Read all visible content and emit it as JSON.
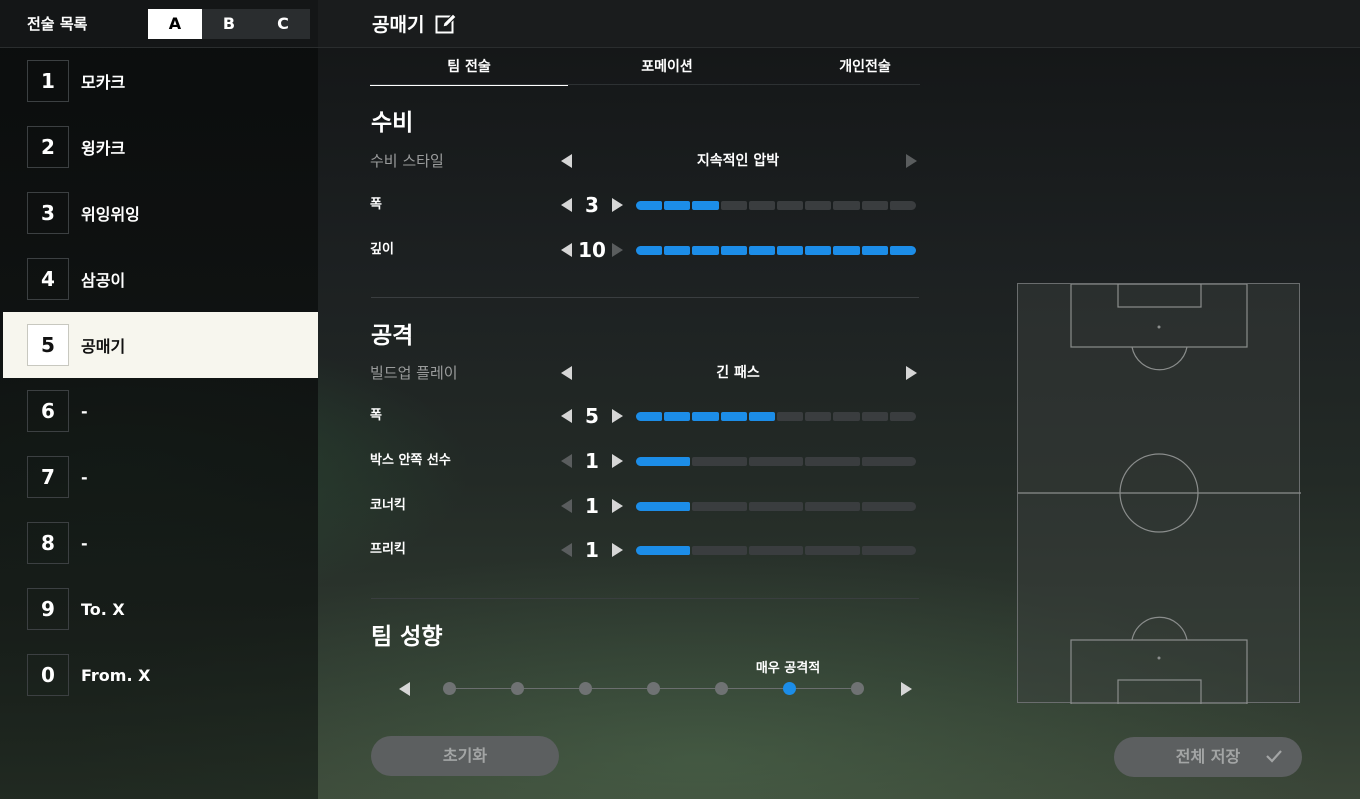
{
  "left_panel": {
    "title": "전술 목록",
    "sets": [
      "A",
      "B",
      "C"
    ],
    "active_set": "A",
    "tactics": [
      {
        "num": "1",
        "name": "모카크"
      },
      {
        "num": "2",
        "name": "윙카크"
      },
      {
        "num": "3",
        "name": "위잉위잉"
      },
      {
        "num": "4",
        "name": "삼공이"
      },
      {
        "num": "5",
        "name": "공매기"
      },
      {
        "num": "6",
        "name": "-"
      },
      {
        "num": "7",
        "name": "-"
      },
      {
        "num": "8",
        "name": "-"
      },
      {
        "num": "9",
        "name": "To. X"
      },
      {
        "num": "0",
        "name": "From. X"
      }
    ],
    "active_index": 4
  },
  "header": {
    "tactic_name": "공매기",
    "edit_icon": "edit-icon"
  },
  "tabs": [
    {
      "label": "팀 전술",
      "active": true
    },
    {
      "label": "포메이션",
      "active": false
    },
    {
      "label": "개인전술",
      "active": false
    }
  ],
  "defense": {
    "title": "수비",
    "style": {
      "label": "수비 스타일",
      "value": "지속적인 압박"
    },
    "width": {
      "label": "폭",
      "value": 3,
      "max": 10
    },
    "depth": {
      "label": "깊이",
      "value": 10,
      "max": 10
    }
  },
  "attack": {
    "title": "공격",
    "buildup": {
      "label": "빌드업 플레이",
      "value": "긴 패스"
    },
    "width": {
      "label": "폭",
      "value": 5,
      "max": 10
    },
    "box_players": {
      "label": "박스 안쪽 선수",
      "value": 1,
      "max": 5
    },
    "corner": {
      "label": "코너킥",
      "value": 1,
      "max": 5
    },
    "freekick": {
      "label": "프리킥",
      "value": 1,
      "max": 5
    }
  },
  "team_mentality": {
    "title": "팀 성향",
    "value_label": "매우 공격적",
    "steps": 7,
    "selected_step": 6
  },
  "buttons": {
    "reset": "초기화",
    "save_all": "전체 저장"
  },
  "colors": {
    "accent": "#1c8de8",
    "active_item_bg": "#f7f6ee"
  }
}
